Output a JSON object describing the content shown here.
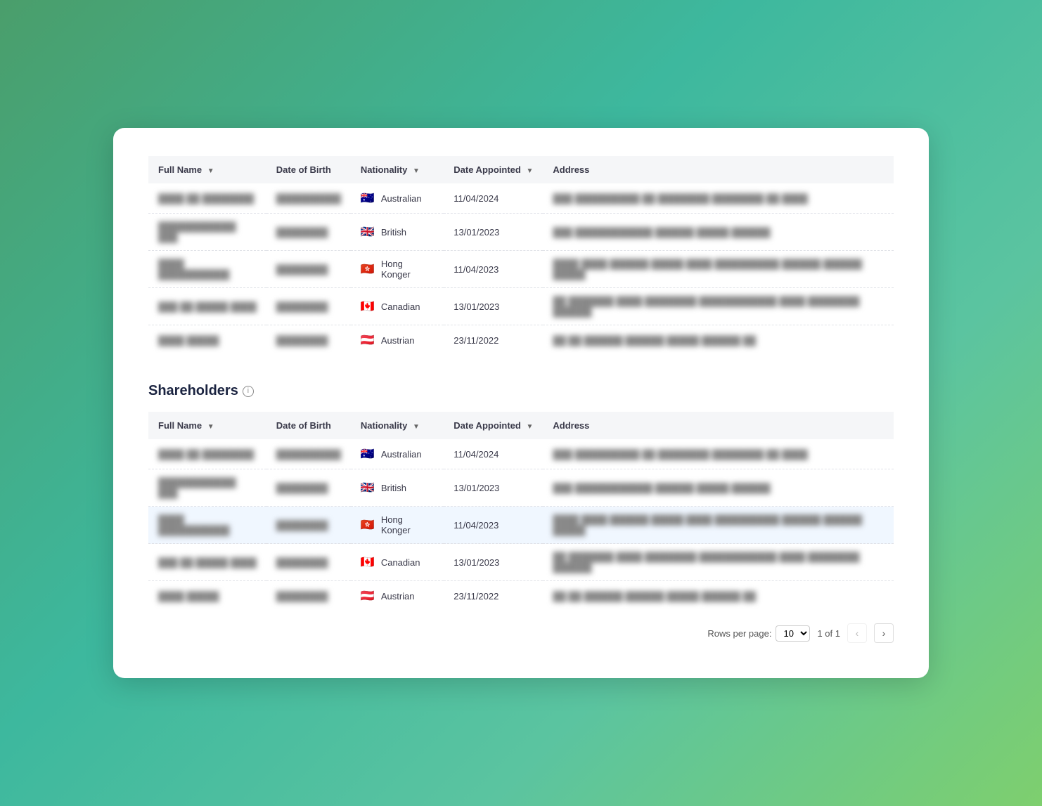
{
  "card": {
    "table1": {
      "columns": [
        {
          "key": "fullName",
          "label": "Full Name",
          "sortable": true
        },
        {
          "key": "dob",
          "label": "Date of Birth",
          "sortable": false
        },
        {
          "key": "nationality",
          "label": "Nationality",
          "sortable": true
        },
        {
          "key": "dateAppointed",
          "label": "Date Appointed",
          "sortable": true
        },
        {
          "key": "address",
          "label": "Address",
          "sortable": false
        }
      ],
      "rows": [
        {
          "name": "████ ██ ████████",
          "dob": "██████████",
          "flag": "🇦🇺",
          "nationality": "Australian",
          "dateAppointed": "11/04/2024",
          "address": "███ ██████████ ██ ████████ ████████ ██ ████",
          "highlighted": false
        },
        {
          "name": "████████████ ███",
          "dob": "████████",
          "flag": "🇬🇧",
          "nationality": "British",
          "dateAppointed": "13/01/2023",
          "address": "███ ████████████ ██████ █████ ██████",
          "highlighted": false
        },
        {
          "name": "████ ███████████",
          "dob": "████████",
          "flag": "🇭🇰",
          "nationality": "Hong Konger",
          "dateAppointed": "11/04/2023",
          "address": "████ ████ ██████ █████ ████ ██████████ ██████ ██████ █████",
          "highlighted": false
        },
        {
          "name": "███ ██ █████ ████",
          "dob": "████████",
          "flag": "🇨🇦",
          "nationality": "Canadian",
          "dateAppointed": "13/01/2023",
          "address": "██ ███████ ████ ████████ ████████████ ████ ████████ ██████",
          "highlighted": false
        },
        {
          "name": "████ █████",
          "dob": "████████",
          "flag": "🇦🇹",
          "nationality": "Austrian",
          "dateAppointed": "23/11/2022",
          "address": "██ ██ ██████ ██████ █████ ██████ ██",
          "highlighted": false
        }
      ]
    },
    "shareholders": {
      "title": "Shareholders",
      "columns": [
        {
          "key": "fullName",
          "label": "Full Name",
          "sortable": true
        },
        {
          "key": "dob",
          "label": "Date of Birth",
          "sortable": false
        },
        {
          "key": "nationality",
          "label": "Nationality",
          "sortable": true
        },
        {
          "key": "dateAppointed",
          "label": "Date Appointed",
          "sortable": true
        },
        {
          "key": "address",
          "label": "Address",
          "sortable": false
        }
      ],
      "rows": [
        {
          "name": "████ ██ ████████",
          "dob": "██████████",
          "flag": "🇦🇺",
          "nationality": "Australian",
          "dateAppointed": "11/04/2024",
          "address": "███ ██████████ ██ ████████ ████████ ██ ████",
          "highlighted": false
        },
        {
          "name": "████████████ ███",
          "dob": "████████",
          "flag": "🇬🇧",
          "nationality": "British",
          "dateAppointed": "13/01/2023",
          "address": "███ ████████████ ██████ █████ ██████",
          "highlighted": false
        },
        {
          "name": "████ ███████████",
          "dob": "████████",
          "flag": "🇭🇰",
          "nationality": "Hong Konger",
          "dateAppointed": "11/04/2023",
          "address": "████ ████ ██████ █████ ████ ██████████ ██████ ██████ █████",
          "highlighted": true
        },
        {
          "name": "███ ██ █████ ████",
          "dob": "████████",
          "flag": "🇨🇦",
          "nationality": "Canadian",
          "dateAppointed": "13/01/2023",
          "address": "██ ███████ ████ ████████ ████████████ ████ ████████ ██████",
          "highlighted": false
        },
        {
          "name": "████ █████",
          "dob": "████████",
          "flag": "🇦🇹",
          "nationality": "Austrian",
          "dateAppointed": "23/11/2022",
          "address": "██ ██ ██████ ██████ █████ ██████ ██",
          "highlighted": false
        }
      ]
    },
    "pagination": {
      "rowsPerPageLabel": "Rows per page:",
      "rowsPerPageValue": "10",
      "pageInfo": "1 of 1"
    }
  }
}
